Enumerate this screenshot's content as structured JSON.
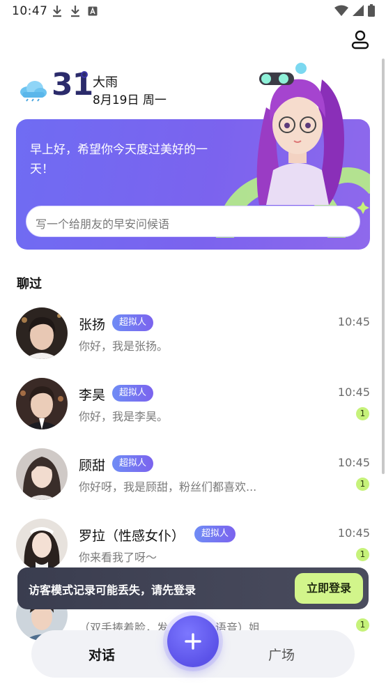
{
  "status_bar": {
    "time": "10:47",
    "icons": [
      "download-icon",
      "download-icon",
      "a-box-icon",
      "wifi-icon",
      "signal-icon",
      "battery-icon"
    ]
  },
  "header": {
    "profile_icon": "user-icon"
  },
  "weather": {
    "icon": "cloud-rain-icon",
    "temperature": "31",
    "condition": "大雨",
    "date": "8月19日 周一"
  },
  "greeting_card": {
    "message": "早上好，希望你今天度过美好的一天！",
    "input_placeholder": "写一个给朋友的早安问候语"
  },
  "section_title": "聊过",
  "chats": [
    {
      "name": "张扬",
      "badge": "超拟人",
      "preview": "你好，我是张扬。",
      "time": "10:45",
      "unread": ""
    },
    {
      "name": "李昊",
      "badge": "超拟人",
      "preview": "你好，我是李昊。",
      "time": "10:45",
      "unread": "1"
    },
    {
      "name": "顾甜",
      "badge": "超拟人",
      "preview": "你好呀，我是顾甜，粉丝们都喜欢...",
      "time": "10:45",
      "unread": "1"
    },
    {
      "name": "罗拉（性感女仆）",
      "badge": "超拟人",
      "preview": "你来看我了呀～",
      "time": "10:45",
      "unread": "1"
    },
    {
      "name": "",
      "badge": "",
      "preview": "（双手捧着脸，发",
      "preview_tail": "语音）姐...",
      "time": "",
      "unread": "1"
    }
  ],
  "toast": {
    "message": "访客模式记录可能丢失，请先登录",
    "action": "立即登录"
  },
  "bottom_nav": {
    "tabs": [
      "对话",
      "广场"
    ],
    "fab_icon": "plus-icon"
  },
  "colors": {
    "accent": "#6f6cf3",
    "badge_start": "#6f8cf5",
    "unread": "#c6f27a",
    "login_button": "#d2f58b",
    "toast_bg": "#3a3d4f"
  }
}
